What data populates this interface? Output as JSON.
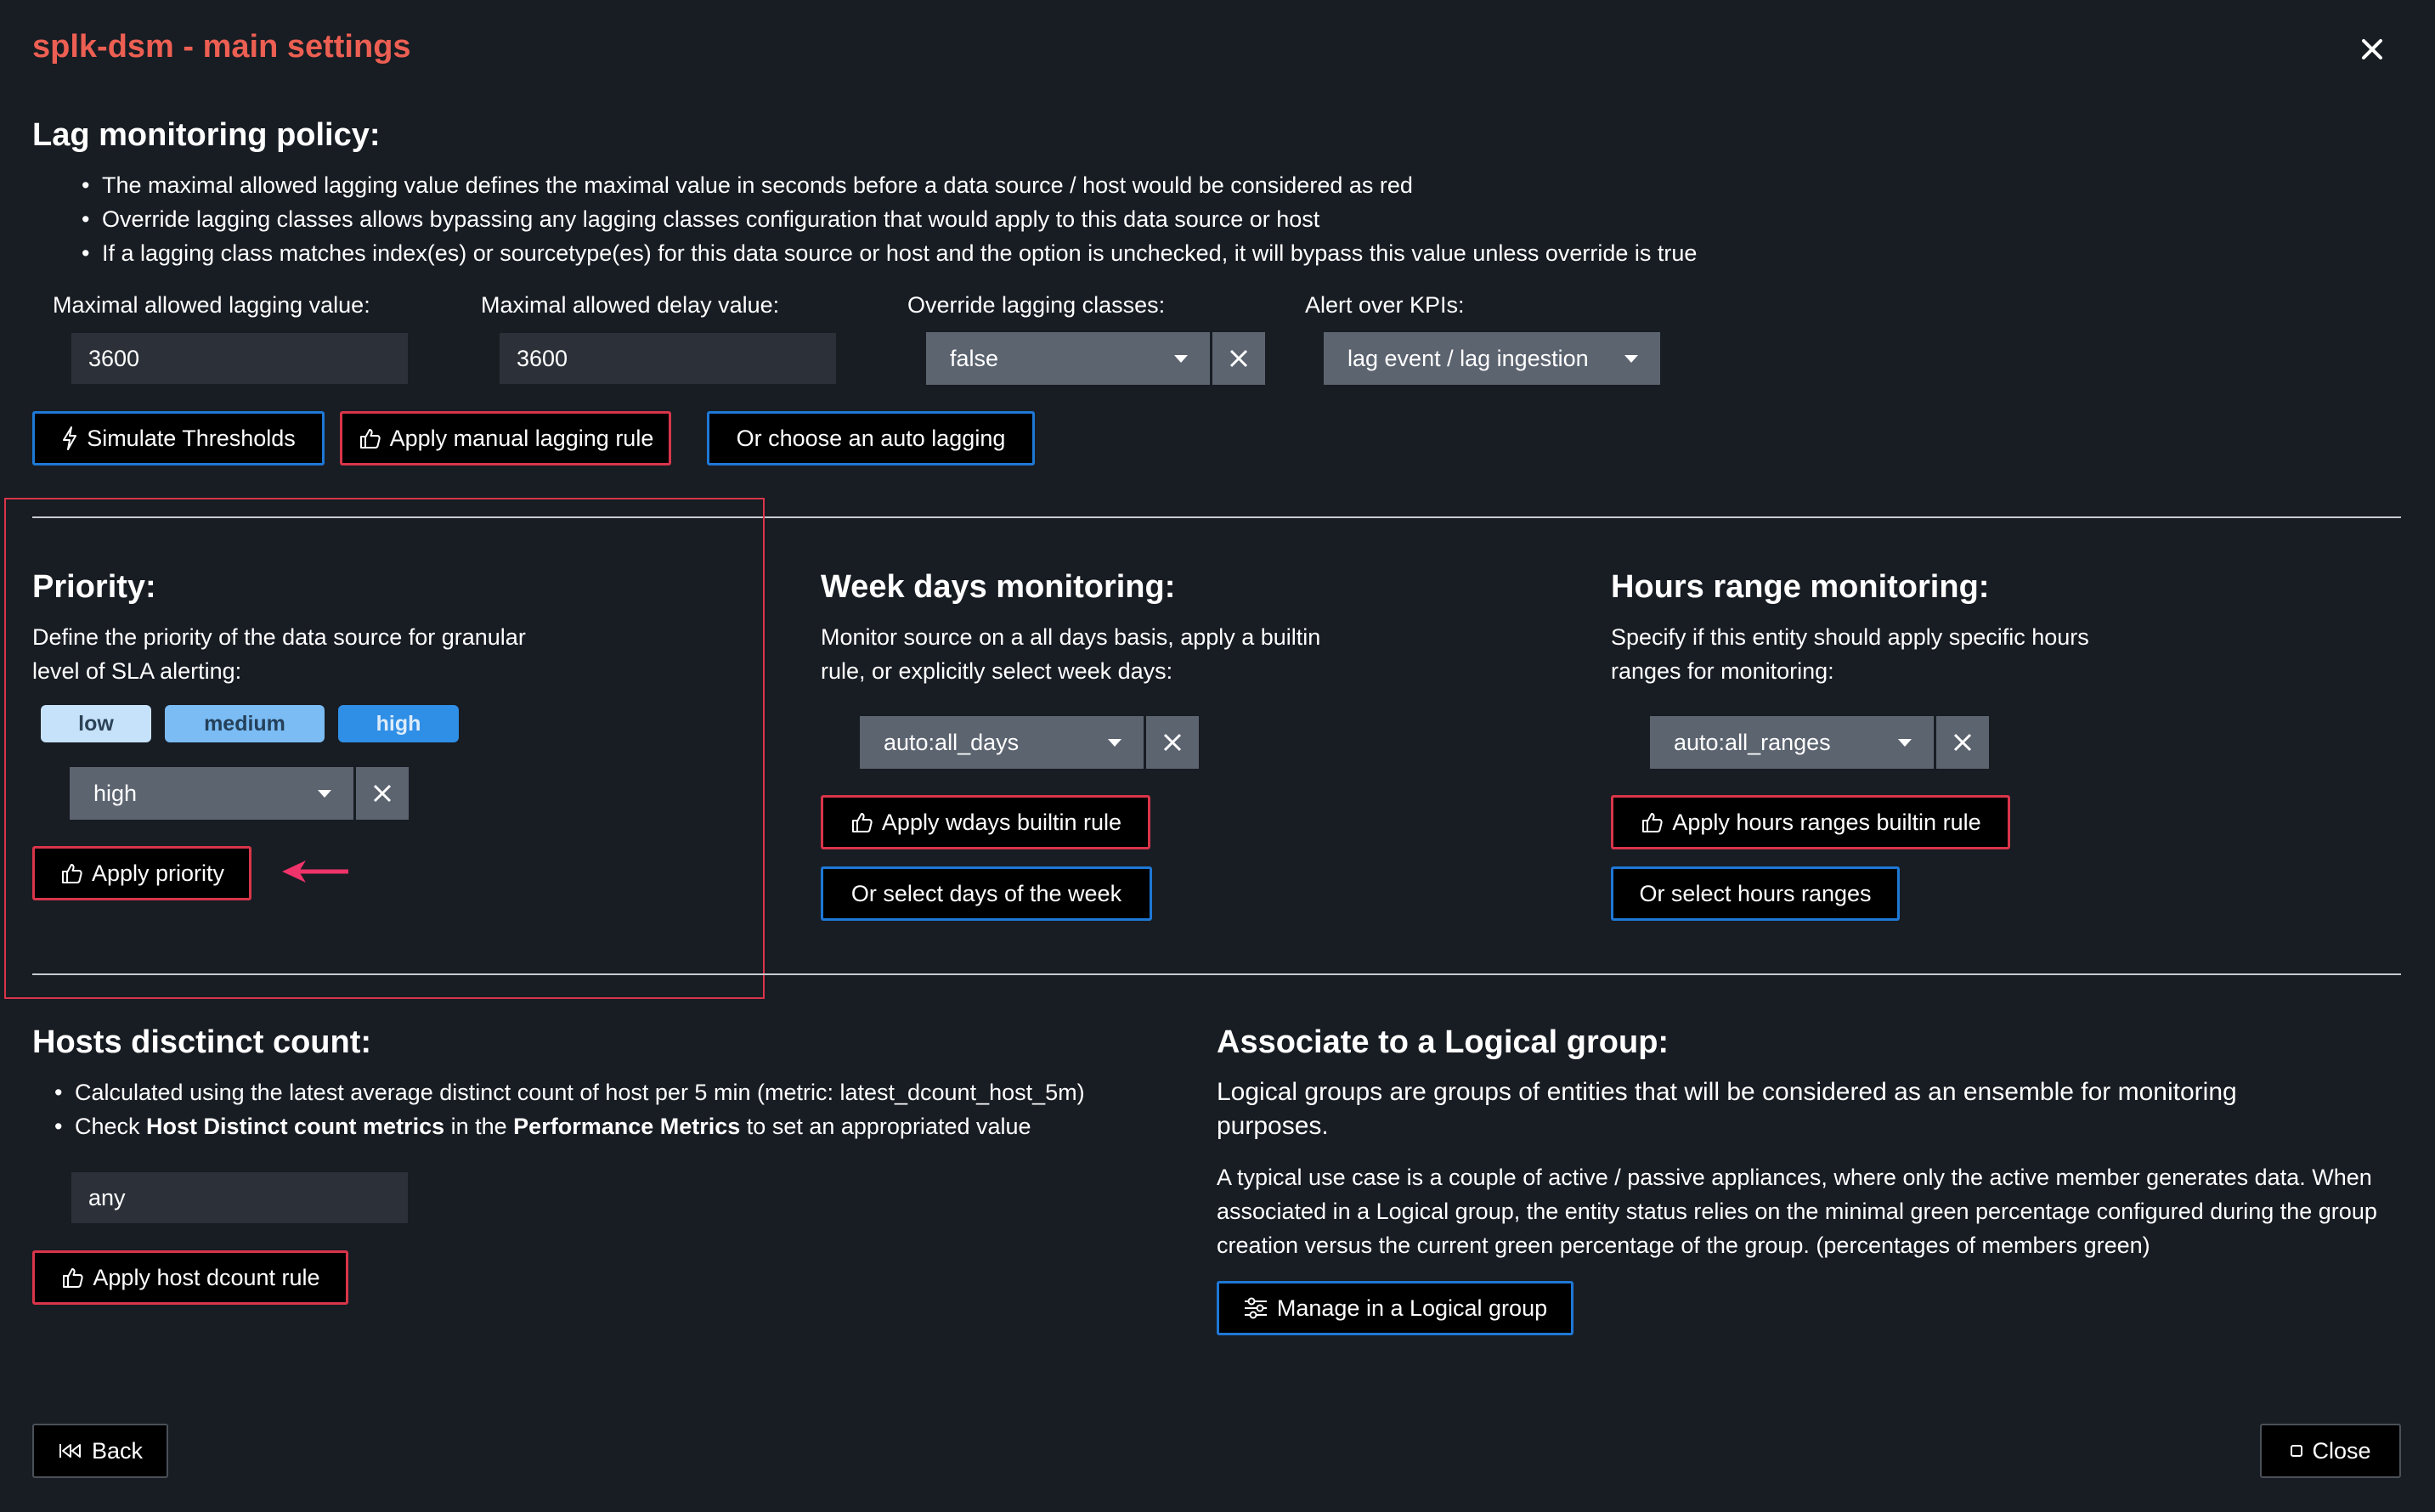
{
  "modal": {
    "title": "splk-dsm - main settings"
  },
  "lag": {
    "heading": "Lag monitoring policy:",
    "bullets": [
      "The maximal allowed lagging value defines the maximal value in seconds before a data source / host would be considered as red",
      "Override lagging classes allows bypassing any lagging classes configuration that would apply to this data source or host",
      "If a lagging class matches index(es) or sourcetype(es) for this data source or host and the option is unchecked, it will bypass this value unless override is true"
    ],
    "max_lag_label": "Maximal allowed lagging value:",
    "max_lag_value": "3600",
    "max_delay_label": "Maximal allowed delay value:",
    "max_delay_value": "3600",
    "override_label": "Override lagging classes:",
    "override_value": "false",
    "alert_label": "Alert over KPIs:",
    "alert_value": "lag event / lag ingestion",
    "simulate_label": "Simulate Thresholds",
    "apply_manual_label": "Apply manual lagging rule",
    "auto_lagging_label": "Or choose an auto lagging"
  },
  "priority": {
    "heading": "Priority:",
    "description": "Define the priority of the data source for granular level of SLA alerting:",
    "pills": [
      "low",
      "medium",
      "high"
    ],
    "selected": "high",
    "apply_label": "Apply priority"
  },
  "weekdays": {
    "heading": "Week days monitoring:",
    "description": "Monitor source on a all days basis, apply a builtin rule, or explicitly select week days:",
    "selected": "auto:all_days",
    "apply_label": "Apply wdays builtin rule",
    "select_label": "Or select days of the week"
  },
  "hours": {
    "heading": "Hours range monitoring:",
    "description": "Specify if this entity should apply specific hours ranges for monitoring:",
    "selected": "auto:all_ranges",
    "apply_label": "Apply hours ranges builtin rule",
    "select_label": "Or select hours ranges"
  },
  "hosts": {
    "heading": "Hosts disctinct count:",
    "bullet1": "Calculated using the latest average distinct count of host per 5 min (metric: latest_dcount_host_5m)",
    "bullet2_pre": "Check ",
    "bullet2_bold1": "Host Distinct count metrics",
    "bullet2_mid": " in the ",
    "bullet2_bold2": "Performance Metrics",
    "bullet2_post": " to set an appropriated value",
    "value": "any",
    "apply_label": "Apply host dcount rule"
  },
  "logical": {
    "heading": "Associate to a Logical group:",
    "lead": "Logical groups are groups of entities that will be considered as an ensemble for monitoring purposes.",
    "detail": "A typical use case is a couple of active / passive appliances, where only the active member generates data. When associated in a Logical group, the entity status relies on the minimal green percentage configured during the group creation versus the current green percentage of the group. (percentages of members green)",
    "manage_label": "Manage in a Logical group"
  },
  "footer": {
    "back_label": "Back",
    "close_label": "Close"
  },
  "colors": {
    "accent_title": "#ec5f52",
    "highlight_box": "#d8354a",
    "arrow": "#f0336a",
    "blue_border": "#1e78d6"
  }
}
